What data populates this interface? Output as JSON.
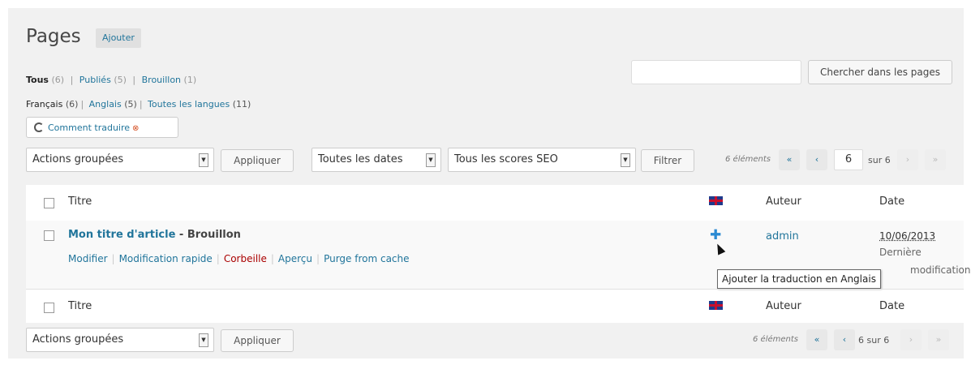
{
  "header": {
    "title": "Pages",
    "add_label": "Ajouter"
  },
  "subsub": [
    {
      "label": "Tous",
      "count": "(6)"
    },
    {
      "label": "Publiés",
      "count": "(5)"
    },
    {
      "label": "Brouillon",
      "count": "(1)"
    }
  ],
  "languages": [
    {
      "label": "Français",
      "count": "(6)"
    },
    {
      "label": "Anglais",
      "count": "(5)"
    },
    {
      "label": "Toutes les langues",
      "count": "(11)"
    }
  ],
  "howto_label": "Comment traduire",
  "search": {
    "button_label": "Chercher dans les pages",
    "value": ""
  },
  "filters": {
    "bulk_top": "Actions groupées",
    "apply_label": "Appliquer",
    "dates": "Toutes les dates",
    "seo": "Tous les scores SEO",
    "filter_label": "Filtrer"
  },
  "pagination": {
    "count_label": "6 éléments",
    "first": "«",
    "prev": "‹",
    "next": "›",
    "last": "»",
    "current": "6",
    "of_label": "sur 6",
    "bottom_current": "6 sur 6"
  },
  "table": {
    "headers": {
      "title": "Titre",
      "author": "Auteur",
      "date": "Date"
    },
    "row": {
      "title": "Mon titre d'article",
      "status": " - Brouillon",
      "actions": [
        "Modifier",
        "Modification rapide",
        "Corbeille",
        "Aperçu",
        "Purge from cache"
      ],
      "author": "admin",
      "date": "10/06/2013",
      "date_sub1": "Dernière",
      "date_sub2": "modification"
    },
    "tooltip": "Ajouter la traduction en Anglais"
  },
  "colors": {
    "link": "#21759b",
    "danger": "#aa0000",
    "background": "#f1f1f1"
  }
}
